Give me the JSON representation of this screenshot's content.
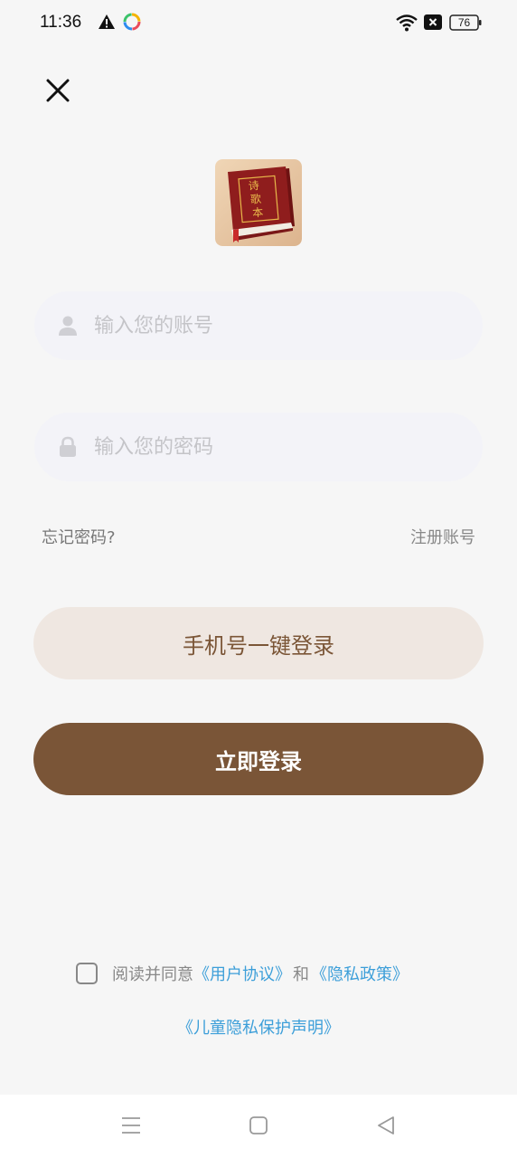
{
  "status_bar": {
    "time": "11:36",
    "battery": "76",
    "icons": [
      "warning-icon",
      "app-notification-icon",
      "wifi-icon",
      "sim-off-icon",
      "battery-icon"
    ]
  },
  "header": {
    "close_icon": "close-icon"
  },
  "logo": {
    "text": [
      "诗",
      "歌",
      "本"
    ],
    "colors": {
      "cover": "#8b1a1a",
      "gold": "#e8b84a",
      "bg": "#e8c9a8"
    }
  },
  "form": {
    "account_placeholder": "输入您的账号",
    "account_value": "",
    "password_placeholder": "输入您的密码",
    "password_value": "",
    "forgot_label": "忘记密码?",
    "register_label": "注册账号"
  },
  "actions": {
    "phone_login_label": "手机号一键登录",
    "login_label": "立即登录"
  },
  "agreement": {
    "checked": false,
    "prefix": "阅读并同意",
    "user_agreement": "《用户协议》",
    "and": "和",
    "privacy_policy": "《隐私政策》",
    "child_privacy": "《儿童隐私保护声明》"
  },
  "colors": {
    "primary": "#7a5537",
    "primary_light": "#efe7e1",
    "link": "#3d9fd9",
    "background": "#f6f6f6"
  }
}
